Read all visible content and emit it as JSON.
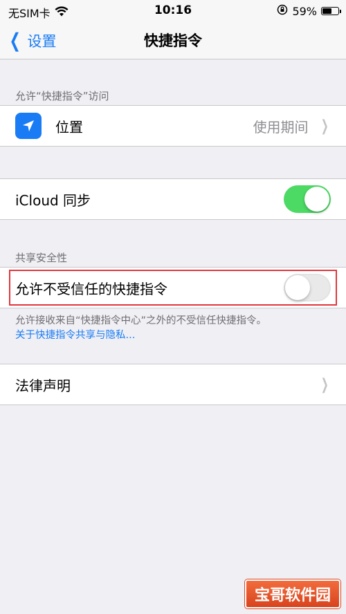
{
  "status_bar": {
    "carrier": "无SIM卡",
    "time": "10:16",
    "battery_percent": "59%",
    "battery_level": 0.59
  },
  "nav": {
    "back_label": "设置",
    "title": "快捷指令"
  },
  "access_section": {
    "header": "允许“快捷指令”访问",
    "location_label": "位置",
    "location_value": "使用期间"
  },
  "icloud_row": {
    "label": "iCloud 同步",
    "enabled": true
  },
  "security_section": {
    "header": "共享安全性",
    "untrusted_label": "允许不受信任的快捷指令",
    "untrusted_enabled": false,
    "note": "允许接收来自“快捷指令中心”之外的不受信任快捷指令。",
    "link": "关于快捷指令共享与隐私..."
  },
  "legal_row": {
    "label": "法律声明"
  },
  "watermark": {
    "text": "宝哥软件园"
  },
  "colors": {
    "accent": "#1a7cf5",
    "toggle_on": "#4cd964",
    "highlight": "#e0363c",
    "background": "#efeff4"
  }
}
